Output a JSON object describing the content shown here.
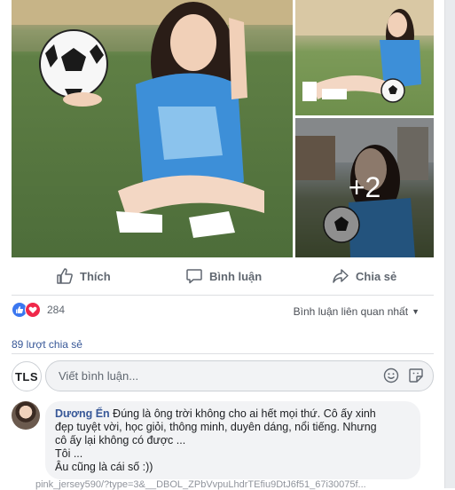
{
  "post": {
    "photos": {
      "more_count": "+2"
    },
    "actions": {
      "like": "Thích",
      "comment": "Bình luận",
      "share": "Chia sẻ"
    },
    "reactions": {
      "count": "284",
      "sort_label": "Bình luận liên quan nhất"
    },
    "shares_label": "89 lượt chia sẻ",
    "composer": {
      "avatar_text": "TLS",
      "placeholder": "Viết bình luận..."
    },
    "comment": {
      "author": "Dương Ển",
      "line1": " Đúng là ông trời không cho ai hết mọi thứ. Cô ấy xinh",
      "line2": "đẹp tuyệt vời, học giỏi, thông minh, duyên dáng, nổi tiếng. Nhưng",
      "line3": "cô ấy lại không có được ...",
      "line4": "Tôi ...",
      "line5": "Âu cũng là cái số :))"
    },
    "url_fragment": "pink_jersey590/?type=3&__DBOL_ZPbVvpuLhdrTEfiu9DtJ6f51_67i30075f..."
  },
  "colors": {
    "link": "#385898",
    "like_blue": "#3b77f0",
    "love_red": "#f0284a",
    "muted": "#606770"
  }
}
